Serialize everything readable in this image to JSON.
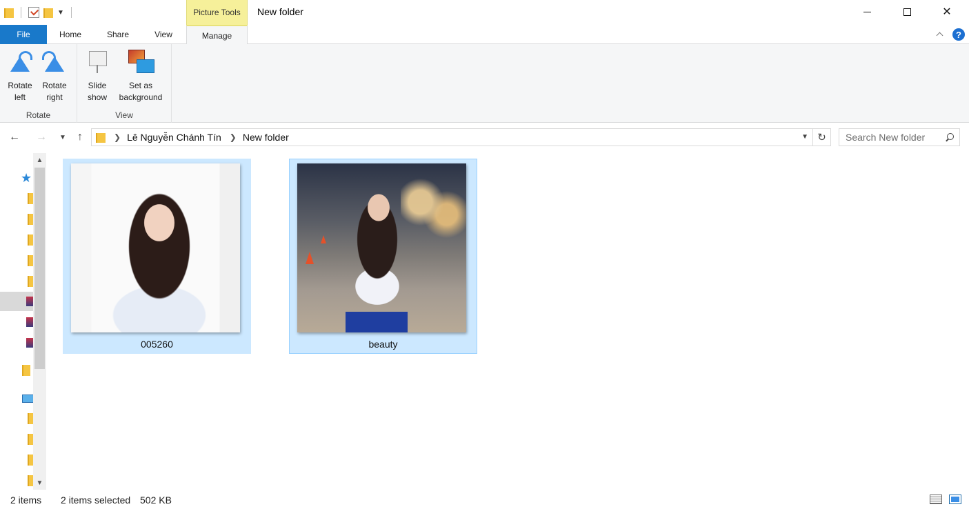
{
  "window": {
    "title": "New folder",
    "context_tab": "Picture Tools"
  },
  "ribbon_tabs": {
    "file": "File",
    "home": "Home",
    "share": "Share",
    "view": "View",
    "manage": "Manage"
  },
  "ribbon": {
    "rotate_left": "Rotate\nleft",
    "rotate_right": "Rotate\nright",
    "group_rotate": "Rotate",
    "slide_show": "Slide\nshow",
    "set_background": "Set as\nbackground",
    "group_view": "View"
  },
  "address": {
    "crumbs": [
      "Lê Nguyễn Chánh Tín",
      "New folder"
    ]
  },
  "search": {
    "placeholder": "Search New folder"
  },
  "files": [
    {
      "name": "005260",
      "selected": true
    },
    {
      "name": "beauty",
      "selected": true
    }
  ],
  "status": {
    "item_count": "2 items",
    "selected": "2 items selected",
    "size": "502 KB"
  },
  "colors": {
    "file_tab": "#1979ca",
    "context_tab": "#f6f09a",
    "selection": "#cce8ff"
  }
}
